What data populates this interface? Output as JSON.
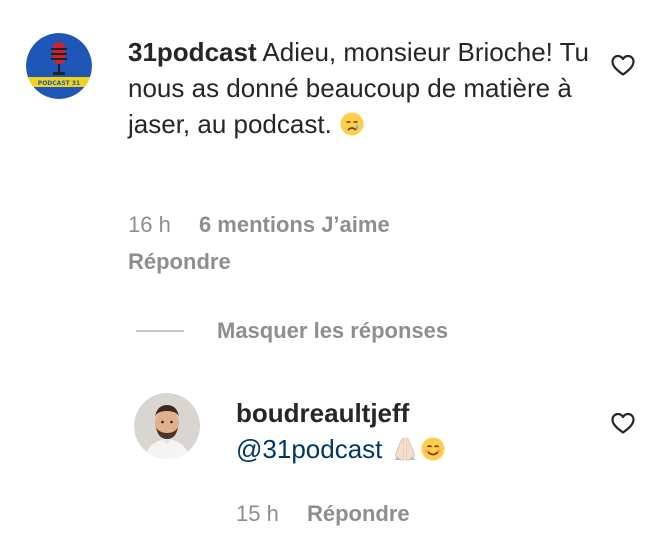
{
  "comments": [
    {
      "username": "31podcast",
      "text": "Adieu, monsieur Brioche! Tu nous as donné beaucoup de matière à jaser, au podcast.",
      "emoji": "😢",
      "time": "16 h",
      "likes": "6 mentions J’aime",
      "reply_label": "Répondre",
      "avatar_text": "PODCAST 31",
      "avatar_colors": {
        "bg": "#1e57b8",
        "accent": "#f2d21b",
        "mic": "#d3202a"
      }
    }
  ],
  "toggle_replies_label": "Masquer les réponses",
  "replies": [
    {
      "username": "boudreaultjeff",
      "mention": "@31podcast",
      "emojis": "🙏🏻😊",
      "time": "15 h",
      "reply_label": "Répondre"
    }
  ],
  "icons": {
    "like": "heart-outline-icon"
  },
  "colors": {
    "text": "#262626",
    "secondary": "#8e8e8e",
    "mention": "#00376b",
    "divider": "#c7c7c7"
  }
}
